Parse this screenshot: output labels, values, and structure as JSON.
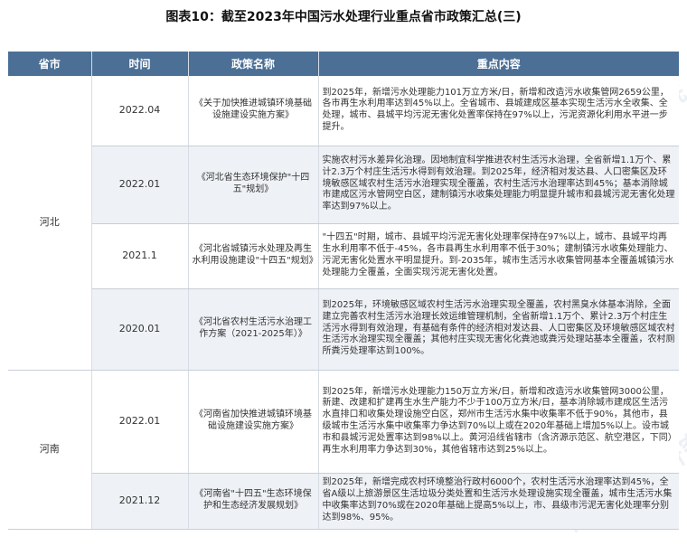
{
  "title": "图表10：截至2023年中国污水处理行业重点省市政策汇总(三)",
  "watermark": "前瞻产业研究院",
  "headers": [
    "省市",
    "时间",
    "政策名称",
    "重点内容"
  ],
  "groups": [
    {
      "province": "河北",
      "rows": [
        {
          "time": "2022.04",
          "name": "《关于加快推进城镇环境基础设施建设实施方案》",
          "content": "到2025年，新增污水处理能力101万立方米/日，新增和改造污水收集管网2659公里，各市再生水利用率达到45%以上。全省城市、县城建成区基本实现生活污水全收集、全处理，城市、县城平均污泥无害化处置率保持在97%以上，污泥资源化利用水平进一步提升。"
        },
        {
          "time": "2022.01",
          "name": "《河北省生态环境保护\"十四五\"规划》",
          "content": "实施农村污水差异化治理。因地制宜科学推进农村生活污水治理，全省新增1.1万个、累计2.3万个村庄生活污水得到有效治理。到2025年，经济相对发达县、人口密集区及环境敏感区域农村生活污水治理实现全覆盖，农村生活污水治理率达到45%；基本消除城市建成区污水管网空白区，建制镇污水收集处理能力明显提升城市和县城污泥无害化处理率达到97%以上。"
        },
        {
          "time": "2021.1",
          "name": "《河北省城镇污水处理及再生水利用设施建设\"十四五\"规划》",
          "content": "\"十四五\"时期，城市、县城平均污泥无害化处理率保持在97%以上，城市、县城平均再生水利用率不低于-45%，各市县再生水利用率不低于30%；建制镇污水收集处理能力、污泥无害化处置水平明显提升。到-2035年，城市生活污水收集管网基本全覆盖城镇污水处理能力全覆盖，全面实现污泥无害化处置。"
        },
        {
          "time": "2020.01",
          "name": "《河北省农村生活污水治理工作方案（2021-2025年）》",
          "content": "到2025年，环境敏感区域农村生活污水治理实现全覆盖，农村黑臭水体基本消除，全面建立完善农村生活污水治理长效运维管理机制，全省新增1.1万个、累计2.3万个村庄生活污水得到有效治理，有基础有条件的经济相对发达县、人口密集区及环境敏感区域农村生活污水治理实现全覆盖；其他村庄实现无害化化粪池或粪污处理站基本全覆盖，农村厕所粪污处理率达到100%。"
        }
      ]
    },
    {
      "province": "河南",
      "rows": [
        {
          "time": "2022.01",
          "name": "《河南省加快推进城镇环境基础设施建设实施方案》",
          "content": "到2025年，新增污水处理能力150万立方米/日，新增和改造污水收集管网3000公里，新建、改建和扩建再生水生产能力不少于100万立方米/日，基本消除城市建成区生活污水直排口和收集处理设施空白区，郑州市生活污水集中收集率不低于90%，其他市，县级城市生活污水集中收集率力争达到70%以上或在2020年基础上增加5%以上。设市城市和县城污泥处置率达到98%以上。黄河沿线省辖市（含济源示范区、航空港区，下同）再生水利用率力争达到30%，其他省辖市达到25%以上。"
        },
        {
          "time": "2021.12",
          "name": "《河南省\"十四五\"生态环境保护和生态经济发展规划》",
          "content": "到2025年，新增完成农村环境整治行政村6000个，农村生活污水治理率达到45%，全省A级以上旅游景区生活垃圾分类处置和生活污水处理设施实现全覆盖，城市生活污水集中收集率达到70%或在2020年基础上提高5%以上，市、县级市污泥无害化处理率分别达到98%、95%。"
        }
      ]
    }
  ]
}
